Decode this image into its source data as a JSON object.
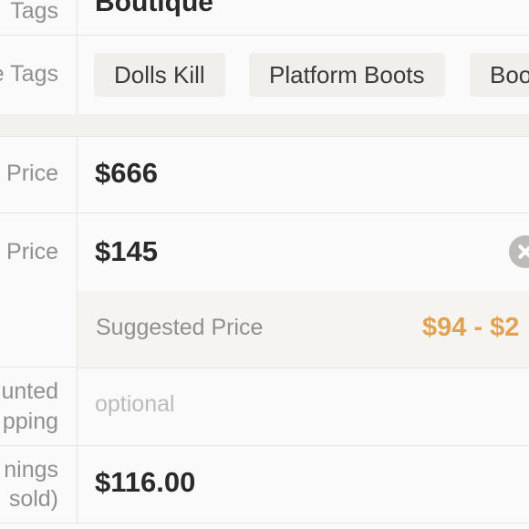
{
  "brand": {
    "label": "Tags",
    "value": "Boutique"
  },
  "style_tags": {
    "label": "e Tags",
    "tags": [
      "Dolls Kill",
      "Platform Boots",
      "Boo"
    ]
  },
  "original_price": {
    "label": "Price",
    "value": "$666"
  },
  "listing_price": {
    "label": "Price",
    "value": "$145",
    "suggested_label": "Suggested Price",
    "suggested_value": "$94 - $2"
  },
  "discounted_shipping": {
    "label_line1": "unted",
    "label_line2": "pping",
    "placeholder": "optional"
  },
  "earnings": {
    "label_line1": "nings",
    "label_line2": "sold)",
    "value": "$116.00"
  },
  "colors": {
    "accent": "#e3a252",
    "label": "#8f8f8f",
    "divider": "#e6e4e1"
  }
}
